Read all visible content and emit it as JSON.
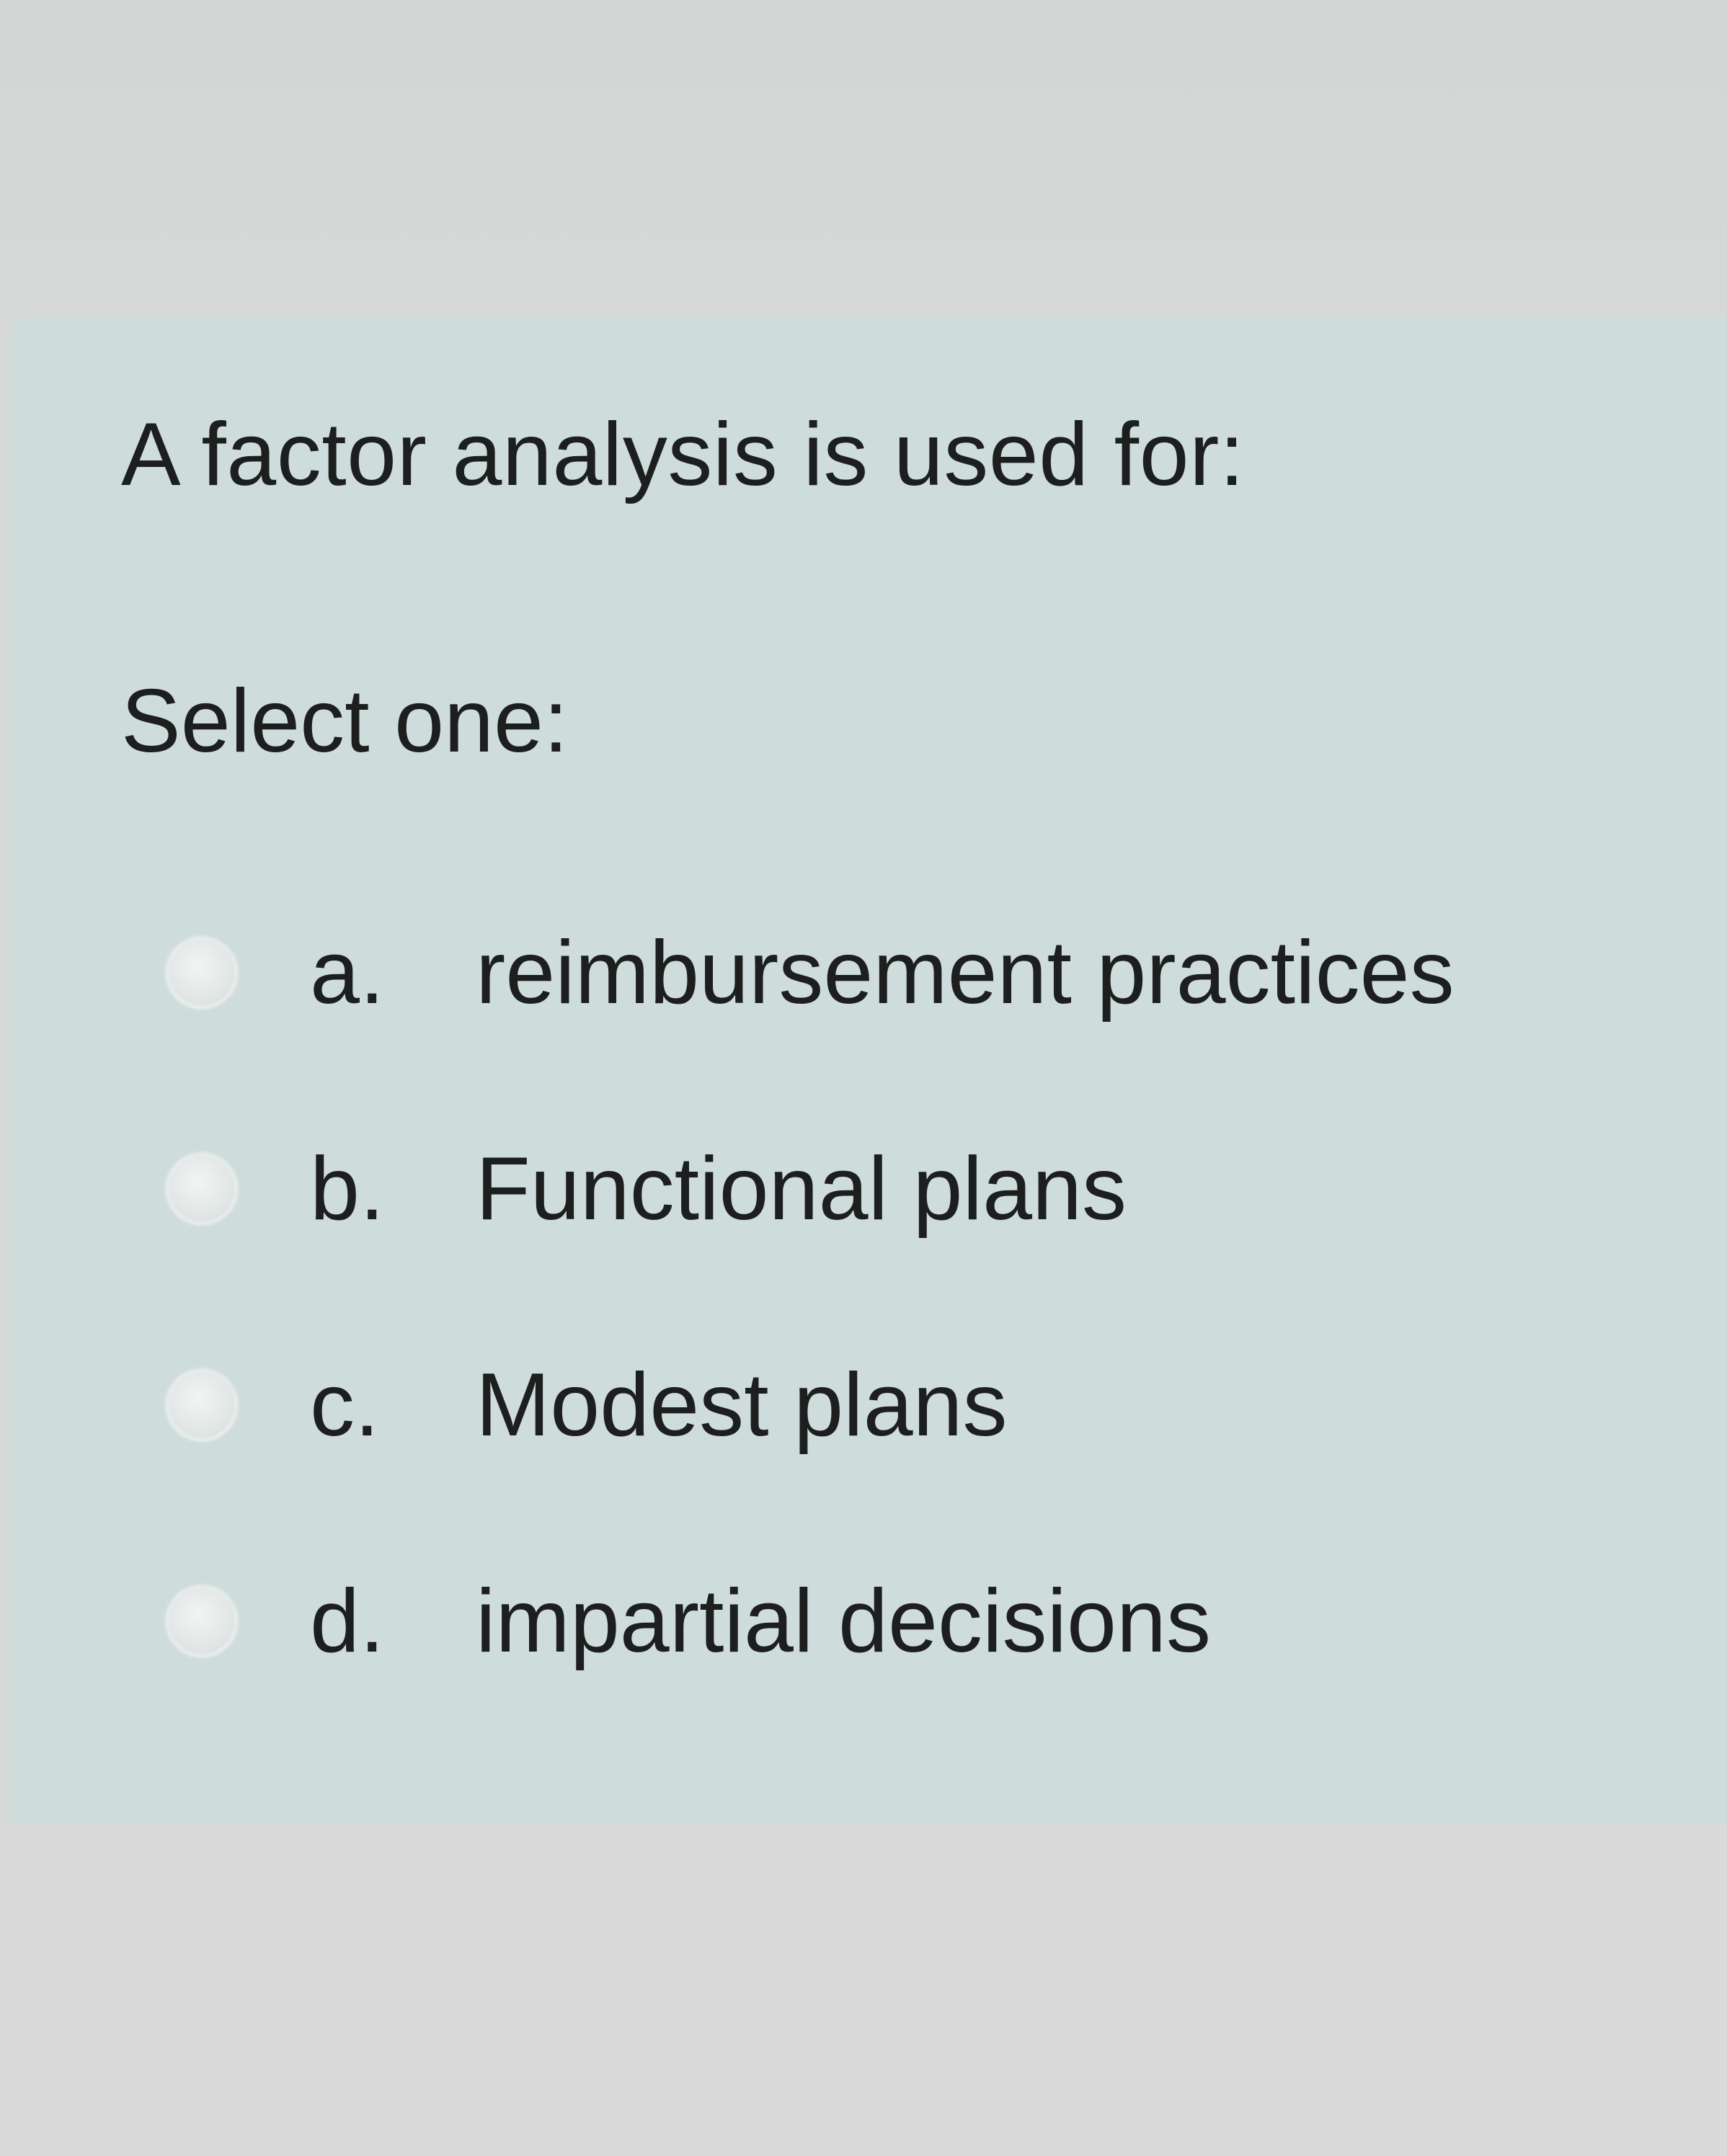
{
  "question": {
    "text": "A factor analysis is used for:",
    "prompt": "Select one:"
  },
  "options": [
    {
      "letter": "a.",
      "label": "reimbursement practices",
      "selected": false
    },
    {
      "letter": "b.",
      "label": "Functional plans",
      "selected": false
    },
    {
      "letter": "c.",
      "label": "Modest plans",
      "selected": false
    },
    {
      "letter": "d.",
      "label": "impartial decisions",
      "selected": false
    }
  ],
  "colors": {
    "card_background": "#cfdcdc",
    "page_background": "#d7d9d8",
    "text": "#1d1f1f"
  }
}
